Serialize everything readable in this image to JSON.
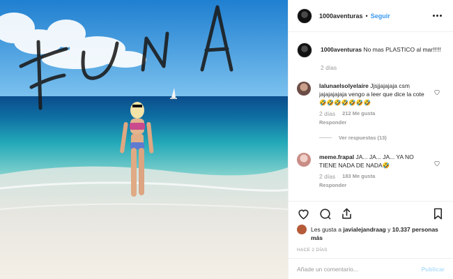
{
  "header": {
    "username": "1000aventuras",
    "separator": "•",
    "follow_label": "Seguir",
    "more_icon": "more-horizontal-icon"
  },
  "photo": {
    "overlay_text": "FUNA"
  },
  "caption": {
    "username": "1000aventuras",
    "text": "No mas PLASTICO al mar!!!!!",
    "time": "2 días"
  },
  "comments": [
    {
      "username": "lalunaelsolyelaire",
      "text": "Jjsjjajajaja csm jajajajajaja vengo a leer que dice la cote 🤣🤣🤣🤣🤣🤣🤣",
      "time": "2 días",
      "likes": "212 Me gusta",
      "reply_label": "Responder"
    },
    {
      "username": "meme.frapal",
      "text": "JA... JA... JA... YA NO TIENE NADA DE NADA🤣",
      "time": "2 días",
      "likes": "183 Me gusta",
      "reply_label": "Responder"
    }
  ],
  "view_replies": "Ver respuestas (13)",
  "likes": {
    "prefix": "Les gusta a",
    "user": "javialejandraag",
    "connector": "y",
    "count": "10.337 personas más"
  },
  "timestamp": "HACE 2 DÍAS",
  "comment_box": {
    "placeholder": "Añade un comentario...",
    "publish_label": "Publicar"
  },
  "colors": {
    "follow": "#3897f0",
    "publish_disabled": "#b2dffc",
    "muted": "#999999"
  }
}
